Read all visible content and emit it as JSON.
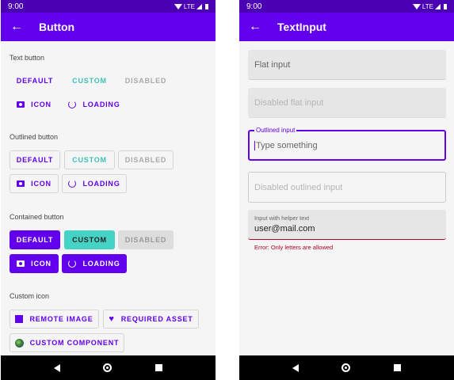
{
  "left": {
    "status_time": "9:00",
    "status_network": "LTE",
    "title": "Button",
    "text_section": "Text button",
    "outlined_section": "Outlined button",
    "contained_section": "Contained button",
    "custom_icon_section": "Custom icon",
    "labels": {
      "default": "DEFAULT",
      "custom": "CUSTOM",
      "disabled": "DISABLED",
      "icon": "ICON",
      "loading": "LOADING"
    },
    "custom_icon_buttons": {
      "remote_image": "REMOTE IMAGE",
      "required_asset": "REQUIRED ASSET",
      "custom_component": "CUSTOM COMPONENT"
    }
  },
  "right": {
    "status_time": "9:00",
    "status_network": "LTE",
    "title": "TextInput",
    "flat_placeholder": "Flat input",
    "disabled_flat_placeholder": "Disabled flat input",
    "outlined_label": "Outlined input",
    "outlined_placeholder": "Type something",
    "disabled_outlined_placeholder": "Disabled outlined input",
    "helper_label": "Input with helper text",
    "helper_value": "user@mail.com",
    "error_text": "Error: Only letters are allowed"
  },
  "colors": {
    "primary": "#6200ee",
    "primary_dark": "#4a00b3",
    "accent": "#44d3c4",
    "error": "#b00020"
  }
}
